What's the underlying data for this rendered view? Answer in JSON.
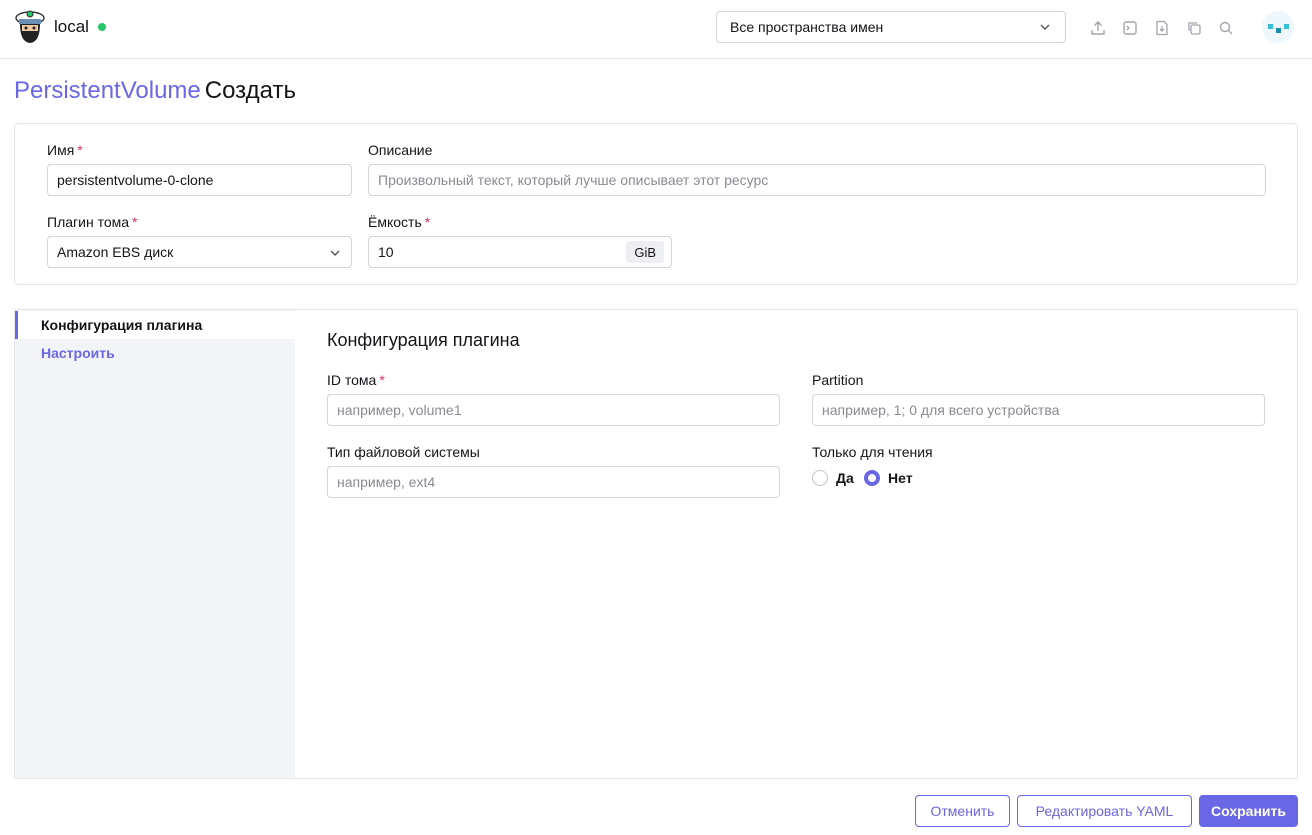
{
  "header": {
    "cluster_name": "local",
    "namespace_select": "Все пространства имен",
    "icons": [
      "upload-icon",
      "terminal-icon",
      "download-icon",
      "copy-icon",
      "search-icon"
    ]
  },
  "page": {
    "resource": "PersistentVolume",
    "action": "Создать"
  },
  "form": {
    "name_label": "Имя",
    "name_value": "persistentvolume-0-clone",
    "description_label": "Описание",
    "description_placeholder": "Произвольный текст, который лучше описывает этот ресурс",
    "plugin_label": "Плагин тома",
    "plugin_value": "Amazon EBS диск",
    "capacity_label": "Ёмкость",
    "capacity_value": "10",
    "capacity_unit": "GiB",
    "required_mark": "*"
  },
  "tabs": [
    {
      "label": "Конфигурация плагина",
      "active": true
    },
    {
      "label": "Настроить",
      "active": false
    }
  ],
  "plugin_config": {
    "title": "Конфигурация плагина",
    "volume_id_label": "ID тома",
    "volume_id_placeholder": "например, volume1",
    "partition_label": "Partition",
    "partition_placeholder": "например, 1; 0 для всего устройства",
    "fs_type_label": "Тип файловой системы",
    "fs_type_placeholder": "например, ext4",
    "readonly_label": "Только для чтения",
    "readonly_yes": "Да",
    "readonly_no": "Нет",
    "readonly_selected": "Нет"
  },
  "footer": {
    "cancel": "Отменить",
    "edit_yaml": "Редактировать YAML",
    "save": "Сохранить"
  },
  "colors": {
    "accent": "#6967e6",
    "required": "#dd2e6a",
    "status_ok": "#27c46a"
  }
}
